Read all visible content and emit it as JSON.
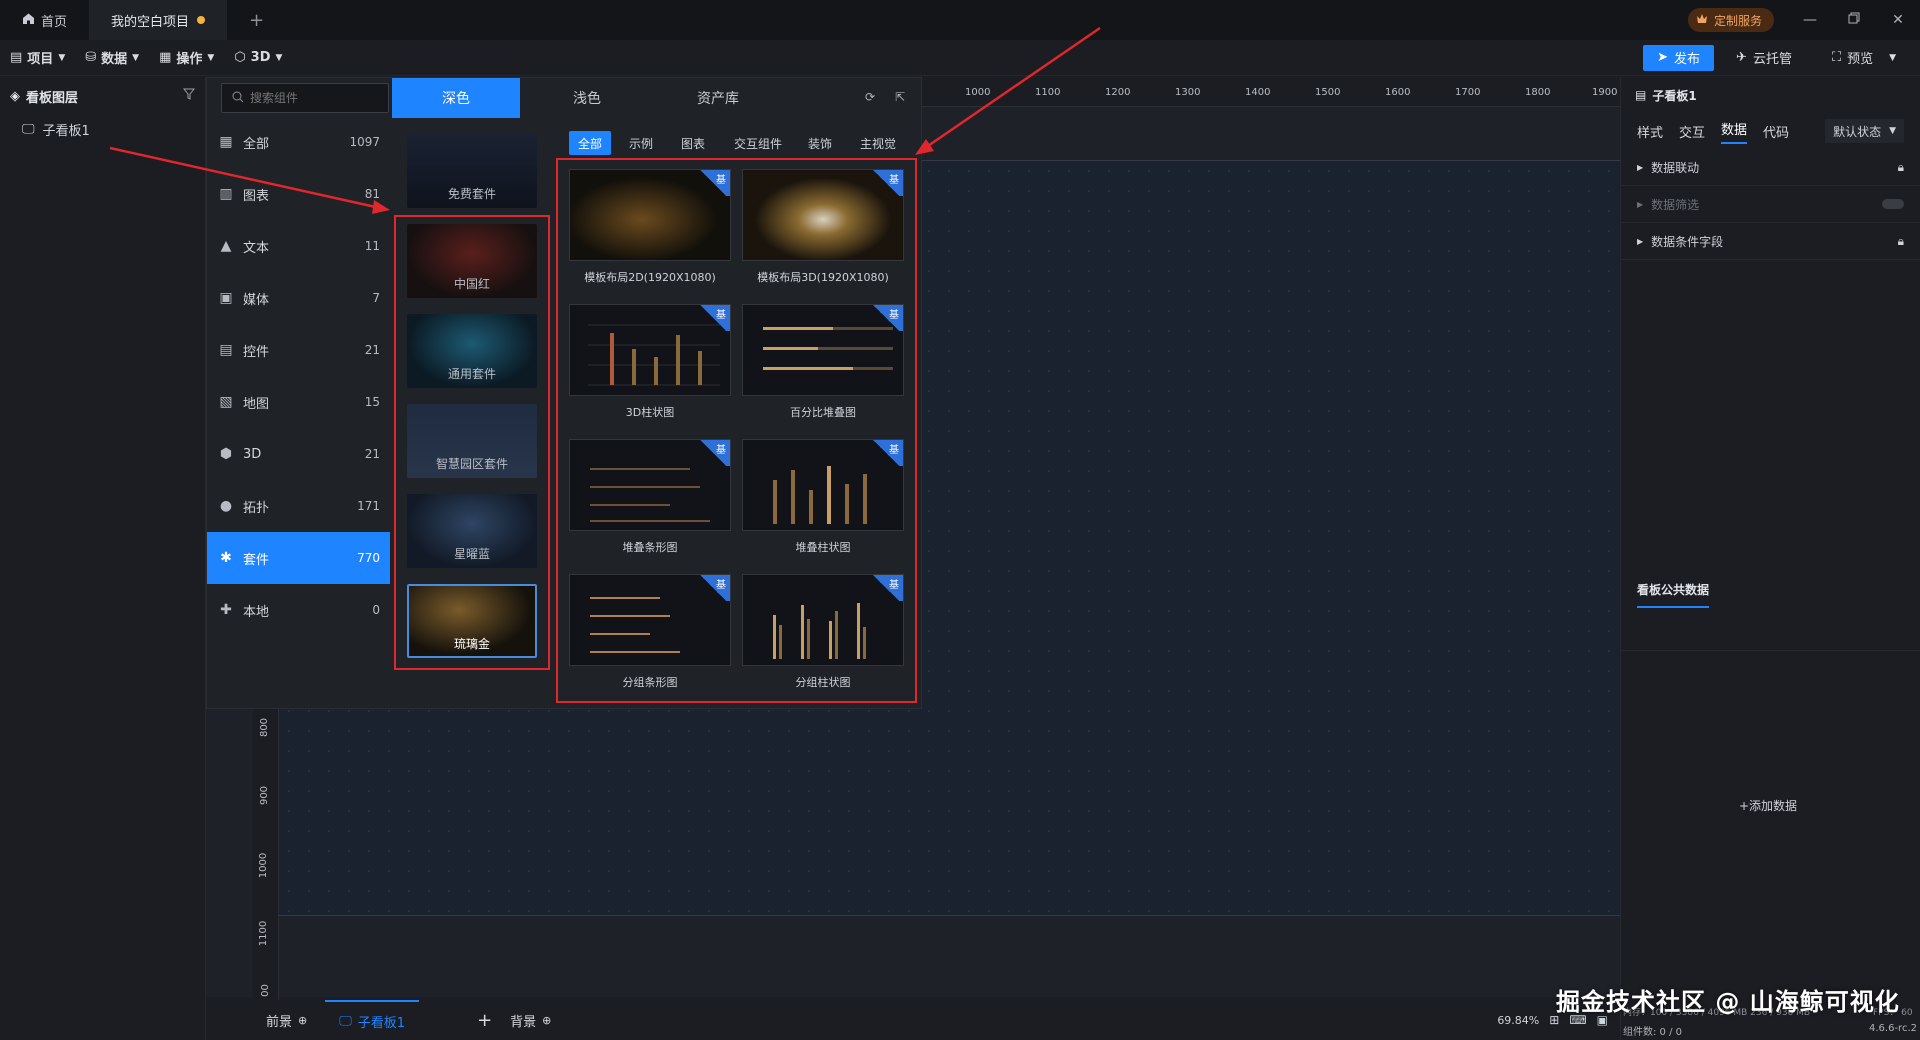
{
  "titlebar": {
    "tabs": [
      {
        "label": "首页",
        "icon": "home-icon"
      },
      {
        "label": "我的空白项目",
        "icon": "",
        "unsaved": true
      }
    ],
    "new_tab": "+",
    "custom_service": "定制服务"
  },
  "menubar": {
    "items": [
      {
        "label": "项目",
        "icon": "document-icon"
      },
      {
        "label": "数据",
        "icon": "database-icon"
      },
      {
        "label": "操作",
        "icon": "grid-icon"
      },
      {
        "label": "3D",
        "icon": "cube-icon"
      }
    ],
    "publish": "发布",
    "cloud": "云托管",
    "preview": "预览"
  },
  "layers": {
    "title": "看板图层",
    "items": [
      {
        "label": "子看板1"
      }
    ]
  },
  "library": {
    "search_placeholder": "搜索组件",
    "theme_tabs": [
      "深色",
      "浅色",
      "资产库"
    ],
    "categories": [
      {
        "label": "全部",
        "count": "1097",
        "icon": "grid-icon"
      },
      {
        "label": "图表",
        "count": "81",
        "icon": "bar-chart-icon"
      },
      {
        "label": "文本",
        "count": "11",
        "icon": "text-icon"
      },
      {
        "label": "媒体",
        "count": "7",
        "icon": "media-icon"
      },
      {
        "label": "控件",
        "count": "21",
        "icon": "widget-icon"
      },
      {
        "label": "地图",
        "count": "15",
        "icon": "map-icon"
      },
      {
        "label": "3D",
        "count": "21",
        "icon": "cube-icon"
      },
      {
        "label": "拓扑",
        "count": "171",
        "icon": "topology-icon"
      },
      {
        "label": "套件",
        "count": "770",
        "icon": "suite-icon",
        "active": true
      },
      {
        "label": "本地",
        "count": "0",
        "icon": "puzzle-icon"
      }
    ],
    "suites": [
      "免费套件",
      "中国红",
      "通用套件",
      "智慧园区套件",
      "星曜蓝",
      "琉璃金"
    ],
    "subtabs": [
      "全部",
      "示例",
      "图表",
      "交互组件",
      "装饰",
      "主视觉"
    ],
    "badge": "基",
    "cards": [
      {
        "title": "模板布局2D(1920X1080)"
      },
      {
        "title": "模板布局3D(1920X1080)"
      },
      {
        "title": "3D柱状图"
      },
      {
        "title": "百分比堆叠图"
      },
      {
        "title": "堆叠条形图"
      },
      {
        "title": "堆叠柱状图"
      },
      {
        "title": "分组条形图"
      },
      {
        "title": "分组柱状图"
      }
    ]
  },
  "rulers": {
    "top": [
      "1000",
      "1100",
      "1200",
      "1300",
      "1400",
      "1500",
      "1600",
      "1700",
      "1800",
      "1900"
    ],
    "left": [
      "800",
      "900",
      "1000",
      "1100",
      "00"
    ]
  },
  "props": {
    "title": "子看板1",
    "tabs": [
      "样式",
      "交互",
      "数据",
      "代码"
    ],
    "state_select": "默认状态",
    "rows": [
      {
        "label": "数据联动"
      },
      {
        "label": "数据筛选"
      },
      {
        "label": "数据条件字段"
      }
    ],
    "public_data": "看板公共数据",
    "add_data": "+添加数据",
    "status_memory": "内存：100 / 3386 / 4096 MB  236 / 936 MB",
    "fps": "FPS： 60",
    "component_count": "组件数: 0 / 0",
    "version": "4.6.6-rc.2"
  },
  "bottombar": {
    "foreground": "前景",
    "board_tab": "子看板1",
    "background": "背景",
    "add": "+",
    "zoom": "69.84%"
  },
  "watermark": "掘金技术社区 @ 山海鲸可视化"
}
